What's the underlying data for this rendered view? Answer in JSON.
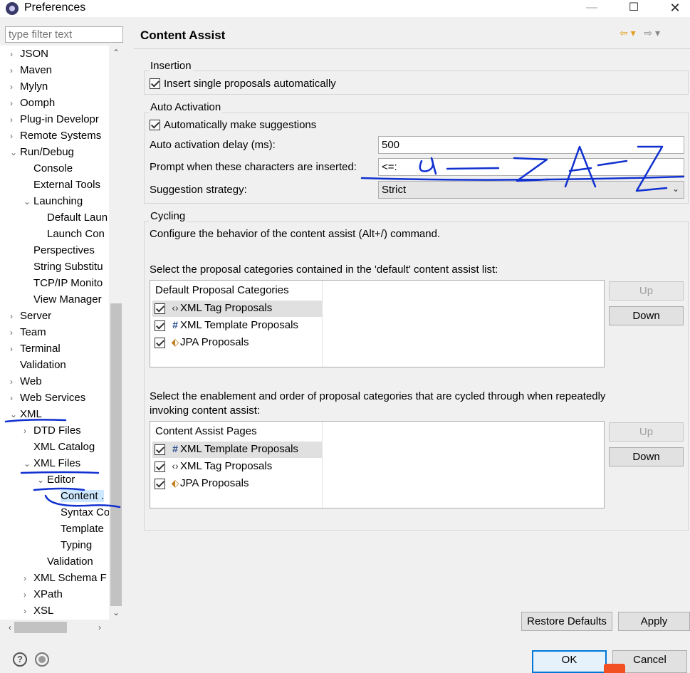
{
  "window": {
    "title": "Preferences",
    "min_glyph": "—",
    "max_glyph": "☐",
    "close_glyph": "✕"
  },
  "filter": {
    "placeholder": "type filter text"
  },
  "tree": [
    {
      "label": "JSON",
      "twisty": "›",
      "indent": 0
    },
    {
      "label": "Maven",
      "twisty": "›",
      "indent": 0
    },
    {
      "label": "Mylyn",
      "twisty": "›",
      "indent": 0
    },
    {
      "label": "Oomph",
      "twisty": "›",
      "indent": 0
    },
    {
      "label": "Plug-in Developr",
      "twisty": "›",
      "indent": 0
    },
    {
      "label": "Remote Systems",
      "twisty": "›",
      "indent": 0
    },
    {
      "label": "Run/Debug",
      "twisty": "⌄",
      "indent": 0
    },
    {
      "label": "Console",
      "twisty": "",
      "indent": 1
    },
    {
      "label": "External Tools",
      "twisty": "",
      "indent": 1
    },
    {
      "label": "Launching",
      "twisty": "⌄",
      "indent": 1
    },
    {
      "label": "Default Laun",
      "twisty": "",
      "indent": 2
    },
    {
      "label": "Launch Con",
      "twisty": "",
      "indent": 2
    },
    {
      "label": "Perspectives",
      "twisty": "",
      "indent": 1
    },
    {
      "label": "String Substitu",
      "twisty": "",
      "indent": 1
    },
    {
      "label": "TCP/IP Monito",
      "twisty": "",
      "indent": 1
    },
    {
      "label": "View Manager",
      "twisty": "",
      "indent": 1
    },
    {
      "label": "Server",
      "twisty": "›",
      "indent": 0
    },
    {
      "label": "Team",
      "twisty": "›",
      "indent": 0
    },
    {
      "label": "Terminal",
      "twisty": "›",
      "indent": 0
    },
    {
      "label": "Validation",
      "twisty": "",
      "indent": 0
    },
    {
      "label": "Web",
      "twisty": "›",
      "indent": 0
    },
    {
      "label": "Web Services",
      "twisty": "›",
      "indent": 0
    },
    {
      "label": "XML",
      "twisty": "⌄",
      "indent": 0
    },
    {
      "label": "DTD Files",
      "twisty": "›",
      "indent": 1
    },
    {
      "label": "XML Catalog",
      "twisty": "",
      "indent": 1
    },
    {
      "label": "XML Files",
      "twisty": "⌄",
      "indent": 1
    },
    {
      "label": "Editor",
      "twisty": "⌄",
      "indent": 2
    },
    {
      "label": "Content .",
      "twisty": "",
      "indent": 3,
      "selected": true
    },
    {
      "label": "Syntax Co",
      "twisty": "",
      "indent": 3
    },
    {
      "label": "Template",
      "twisty": "",
      "indent": 3
    },
    {
      "label": "Typing",
      "twisty": "",
      "indent": 3
    },
    {
      "label": "Validation",
      "twisty": "",
      "indent": 2
    },
    {
      "label": "XML Schema F",
      "twisty": "›",
      "indent": 1
    },
    {
      "label": "XPath",
      "twisty": "›",
      "indent": 1
    },
    {
      "label": "XSL",
      "twisty": "›",
      "indent": 1
    }
  ],
  "scroll": {
    "up": "⌃",
    "down": "⌄",
    "left": "‹",
    "right": "›"
  },
  "page": {
    "title": "Content Assist",
    "nav_back": "⇦ ▾",
    "nav_fwd": "⇨ ▾",
    "insertion": {
      "group": "Insertion",
      "single_label": "Insert single proposals automatically",
      "single_checked": true
    },
    "auto_activation": {
      "group": "Auto Activation",
      "make_suggestions_label": "Automatically make suggestions",
      "make_suggestions_checked": true,
      "delay_label": "Auto activation delay (ms):",
      "delay_value": "500",
      "prompt_label": "Prompt when these characters are inserted:",
      "prompt_value": "<=:",
      "strategy_label": "Suggestion strategy:",
      "strategy_value": "Strict"
    },
    "cycling": {
      "group": "Cycling",
      "description": "Configure the behavior of the content assist (Alt+/) command.",
      "default_list_label": "Select the proposal categories contained in the 'default' content assist list:",
      "default_list": {
        "header": "Default Proposal Categories",
        "rows": [
          {
            "icon": "xml-tag-icon",
            "glyph": "‹›",
            "label": "XML Tag Proposals",
            "checked": true
          },
          {
            "icon": "hash-icon",
            "glyph": "#",
            "label": "XML Template Proposals",
            "checked": true
          },
          {
            "icon": "jpa-icon",
            "glyph": "⬖",
            "label": "JPA Proposals",
            "checked": true
          }
        ],
        "up": "Up",
        "down": "Down"
      },
      "cycled_list_label_1": "Select the enablement and order of proposal categories that are cycled through when repeatedly",
      "cycled_list_label_2": "invoking content assist:",
      "cycled_list": {
        "header": "Content Assist Pages",
        "rows": [
          {
            "icon": "hash-icon",
            "glyph": "#",
            "label": "XML Template Proposals",
            "checked": true
          },
          {
            "icon": "xml-tag-icon",
            "glyph": "‹›",
            "label": "XML Tag Proposals",
            "checked": true
          },
          {
            "icon": "jpa-icon",
            "glyph": "⬖",
            "label": "JPA Proposals",
            "checked": true
          }
        ],
        "up": "Up",
        "down": "Down"
      }
    },
    "restore_defaults": "Restore Defaults",
    "apply": "Apply"
  },
  "footer": {
    "help": "?",
    "ok": "OK",
    "cancel": "Cancel"
  },
  "colors": {
    "selection": "#cde8ff",
    "annotation_ink": "#1030d0",
    "default_button_border": "#0078d7"
  }
}
